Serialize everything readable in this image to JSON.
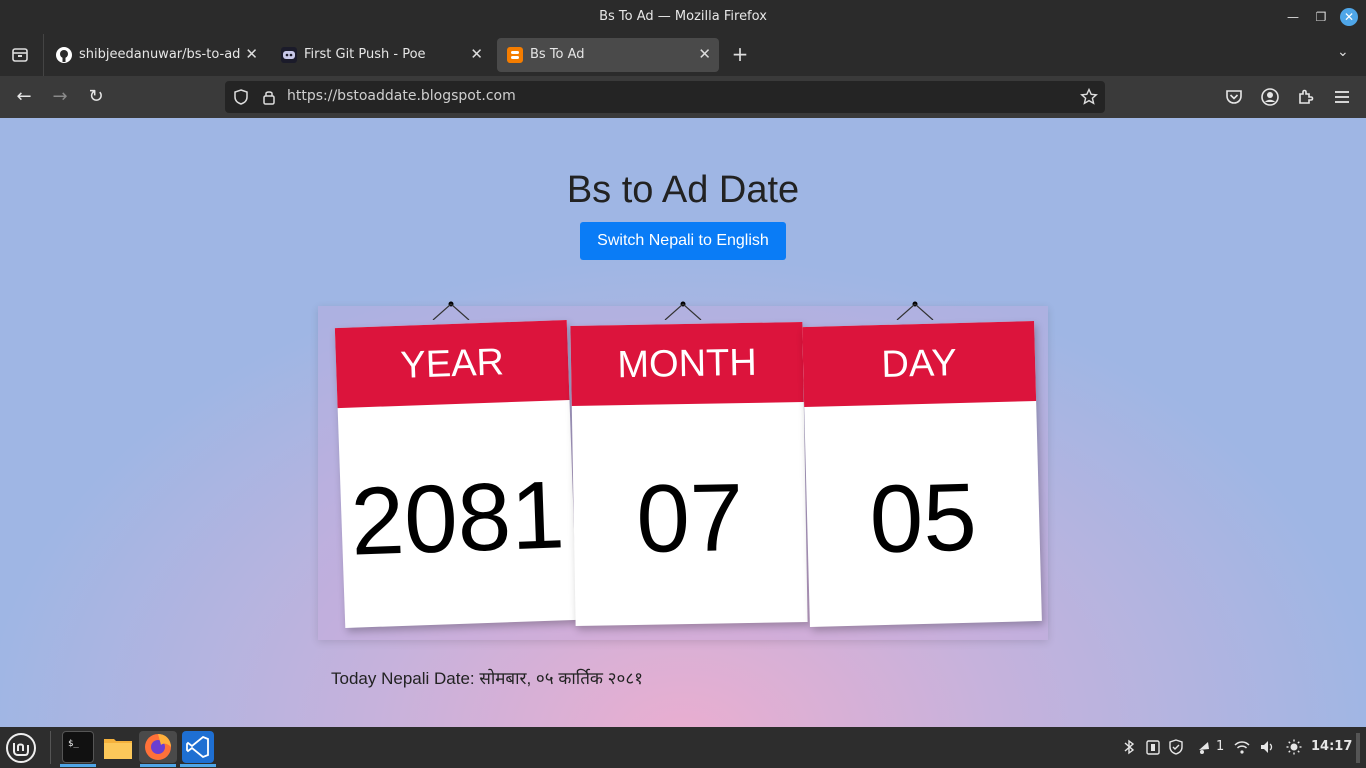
{
  "window": {
    "title": "Bs To Ad — Mozilla Firefox"
  },
  "tabs": [
    {
      "label": "shibjeedanuwar/bs-to-ad: w",
      "icon": "github-icon"
    },
    {
      "label": "First Git Push - Poe",
      "icon": "poe-icon"
    },
    {
      "label": "Bs To Ad",
      "icon": "blogger-icon",
      "active": true
    }
  ],
  "url": {
    "value": "https://bstoaddate.blogspot.com"
  },
  "page": {
    "title": "Bs to Ad Date",
    "switch_label": "Switch Nepali to English",
    "cards": [
      {
        "head": "YEAR",
        "value": "2081"
      },
      {
        "head": "MONTH",
        "value": "07"
      },
      {
        "head": "DAY",
        "value": "05"
      }
    ],
    "nepali_date": "Today Nepali Date: सोमबार, ०५ कार्तिक २०८१"
  },
  "taskbar": {
    "notif_count": "1",
    "clock": "14:17"
  },
  "colors": {
    "accent": "#0a7cf6",
    "card_header": "#dc143c"
  }
}
